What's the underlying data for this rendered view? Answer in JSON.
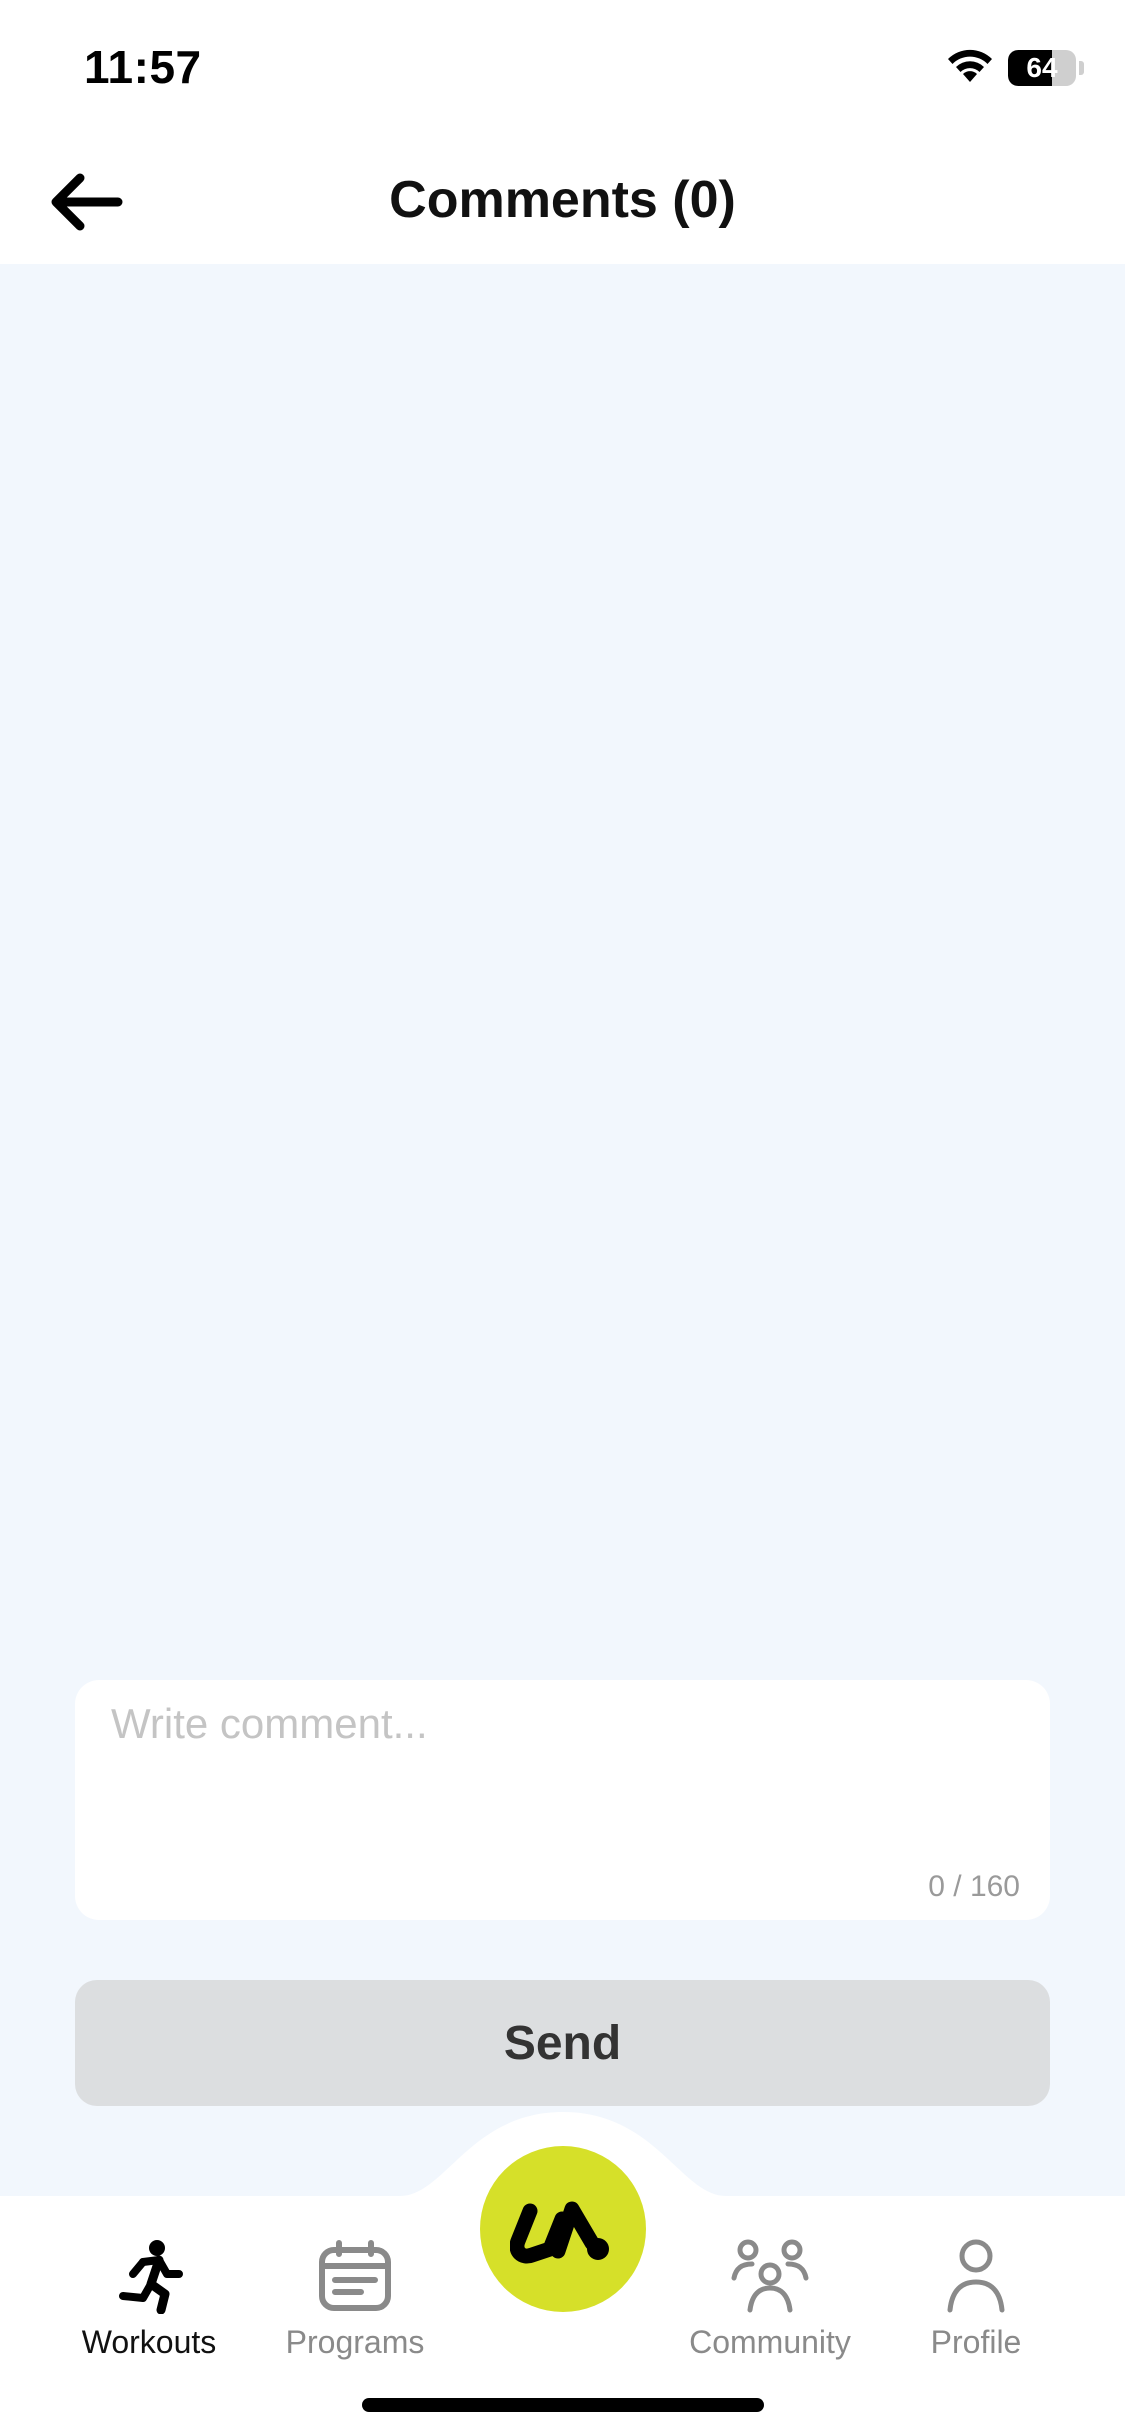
{
  "status_bar": {
    "time": "11:57",
    "battery_level": "64",
    "battery_fraction": 0.64
  },
  "header": {
    "title": "Comments (0)",
    "back_icon": "arrow-left-icon"
  },
  "comment_form": {
    "value": "",
    "placeholder": "Write comment...",
    "counter": "0 / 160",
    "send_label": "Send"
  },
  "tab_bar": {
    "items": [
      {
        "label": "Workouts",
        "icon": "running-person-icon",
        "active": true
      },
      {
        "label": "Programs",
        "icon": "calendar-icon",
        "active": false
      },
      {
        "label": "",
        "icon": "app-logo-icon",
        "active": false
      },
      {
        "label": "Community",
        "icon": "people-group-icon",
        "active": false
      },
      {
        "label": "Profile",
        "icon": "person-icon",
        "active": false
      }
    ]
  },
  "colors": {
    "background": "#f2f7fd",
    "accent": "#d6e029",
    "send_disabled": "#dcdee0",
    "tab_inactive": "#8a8a8a"
  }
}
